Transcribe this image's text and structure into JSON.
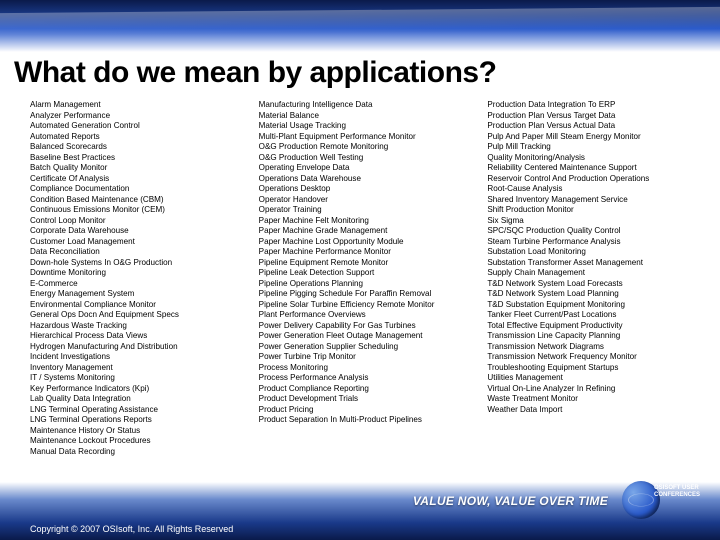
{
  "title": "What do we mean by applications?",
  "columns": [
    [
      "Alarm Management",
      "Analyzer Performance",
      "Automated Generation Control",
      "Automated Reports",
      "Balanced Scorecards",
      "Baseline Best Practices",
      "Batch Quality Monitor",
      "Certificate Of Analysis",
      "Compliance Documentation",
      "Condition Based Maintenance (CBM)",
      "Continuous Emissions Monitor (CEM)",
      "Control Loop Monitor",
      "Corporate Data Warehouse",
      "Customer Load Management",
      "Data Reconciliation",
      "Down-hole Systems In O&G Production",
      "Downtime Monitoring",
      "E-Commerce",
      "Energy Management System",
      "Environmental Compliance Monitor",
      "General Ops Docn And Equipment Specs",
      "Hazardous Waste Tracking",
      "Hierarchical Process Data Views",
      "Hydrogen Manufacturing And Distribution",
      "Incident Investigations",
      "Inventory Management",
      "IT / Systems Monitoring",
      "Key Performance Indicators (Kpi)",
      "Lab Quality Data Integration",
      "LNG Terminal Operating Assistance",
      "LNG Terminal Operations Reports",
      "Maintenance History Or Status",
      "Maintenance Lockout Procedures",
      "Manual Data Recording"
    ],
    [
      "Manufacturing Intelligence Data",
      "Material Balance",
      "Material Usage Tracking",
      "Multi-Plant Equipment Performance Monitor",
      "O&G Production Remote Monitoring",
      "O&G Production Well Testing",
      "Operating Envelope Data",
      "Operations Data Warehouse",
      "Operations Desktop",
      "Operator Handover",
      "Operator Training",
      "Paper Machine Felt Monitoring",
      "Paper Machine Grade Management",
      "Paper Machine Lost Opportunity Module",
      "Paper Machine Performance Monitor",
      "Pipeline Equipment Remote Monitor",
      "Pipeline Leak Detection Support",
      "Pipeline Operations Planning",
      "Pipeline Pigging Schedule For Paraffin Removal",
      "Pipeline Solar Turbine Efficiency Remote Monitor",
      "Plant Performance Overviews",
      "Power Delivery Capability For Gas Turbines",
      "Power Generation Fleet Outage Management",
      "Power Generation Supplier Scheduling",
      "Power Turbine Trip Monitor",
      "Process Monitoring",
      "Process Performance Analysis",
      "Product Compliance Reporting",
      "Product Development Trials",
      "Product Pricing",
      "Product Separation In Multi-Product Pipelines"
    ],
    [
      "Production Data Integration To ERP",
      "Production Plan Versus Target Data",
      "Production Plan Versus Actual Data",
      "Pulp And Paper Mill Steam Energy Monitor",
      "Pulp Mill Tracking",
      "Quality Monitoring/Analysis",
      "Reliability Centered Maintenance Support",
      "Reservoir Control And Production Operations",
      "Root-Cause Analysis",
      "Shared Inventory Management Service",
      "Shift Production Monitor",
      "Six Sigma",
      "SPC/SQC Production Quality Control",
      "Steam Turbine Performance Analysis",
      "Substation Load Monitoring",
      "Substation Transformer Asset Management",
      "Supply Chain Management",
      "T&D Network System Load Forecasts",
      "T&D Network System Load Planning",
      "T&D Substation Equipment Monitoring",
      "Tanker Fleet Current/Past Locations",
      "Total Effective Equipment Productivity",
      "Transmission Line Capacity Planning",
      "Transmission Network Diagrams",
      "Transmission Network Frequency Monitor",
      "Troubleshooting Equipment Startups",
      "Utilities Management",
      "Virtual On-Line Analyzer In Refining",
      "Waste Treatment Monitor",
      "Weather Data Import"
    ]
  ],
  "tagline": "VALUE NOW, VALUE OVER TIME",
  "logo": {
    "line1": "OSISOFT USER",
    "line2": "CONFERENCES"
  },
  "copyright": "Copyright © 2007 OSIsoft, Inc. All Rights Reserved"
}
